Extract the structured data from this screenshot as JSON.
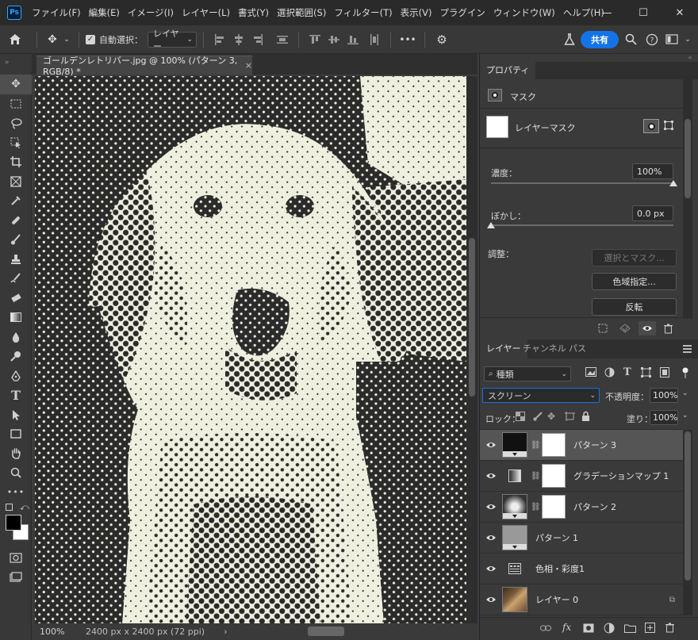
{
  "menu": {
    "logo": "Ps",
    "items": [
      "ファイル(F)",
      "編集(E)",
      "イメージ(I)",
      "レイヤー(L)",
      "書式(Y)",
      "選択範囲(S)",
      "フィルター(T)",
      "表示(V)",
      "プラグイン",
      "ウィンドウ(W)",
      "ヘルプ(H)"
    ],
    "minimize": "—",
    "maximize": "☐",
    "close": "✕"
  },
  "options": {
    "auto_select_label": "自動選択：",
    "auto_select_target": "レイヤー",
    "more": "•••",
    "share": "共有"
  },
  "document": {
    "tab_title": "ゴールデンレトリバー.jpg @ 100% (パターン 3, RGB/8) *",
    "close": "×",
    "zoom": "100%",
    "size": "2400 px x 2400 px (72 ppi)",
    "chevron": "›"
  },
  "toolbar_strip": "»",
  "properties": {
    "tab": "プロパティ",
    "section": "マスク",
    "mask_label": "レイヤーマスク",
    "density_label": "濃度：",
    "density_value": "100%",
    "density_fraction": 1.0,
    "feather_label": "ぼかし：",
    "feather_value": "0.0 px",
    "feather_fraction": 0.0,
    "refine_label": "調整：",
    "select_mask_btn": "選択とマスク...",
    "color_range_btn": "色域指定...",
    "invert_btn": "反転"
  },
  "layers_panel": {
    "tabs": [
      "レイヤー",
      "チャンネル",
      "パス"
    ],
    "filter_label": "種類",
    "blend_mode": "スクリーン",
    "opacity_label": "不透明度：",
    "opacity_value": "100%",
    "lock_label": "ロック：",
    "fill_label": "塗り：",
    "fill_value": "100%",
    "layers": [
      {
        "name": "パターン 3",
        "selected": true,
        "type": "pattern-dark",
        "mask": true
      },
      {
        "name": "グラデーションマップ 1",
        "selected": false,
        "type": "gradient-map",
        "mask": true
      },
      {
        "name": "パターン 2",
        "selected": false,
        "type": "pattern-radial",
        "mask": true
      },
      {
        "name": "パターン 1",
        "selected": false,
        "type": "pattern-gray",
        "mask": false
      },
      {
        "name": "色相・彩度1",
        "selected": false,
        "type": "hue-sat",
        "mask": false
      },
      {
        "name": "レイヤー 0",
        "selected": false,
        "type": "photo",
        "mask": false
      }
    ],
    "footer_fx": "fx"
  }
}
